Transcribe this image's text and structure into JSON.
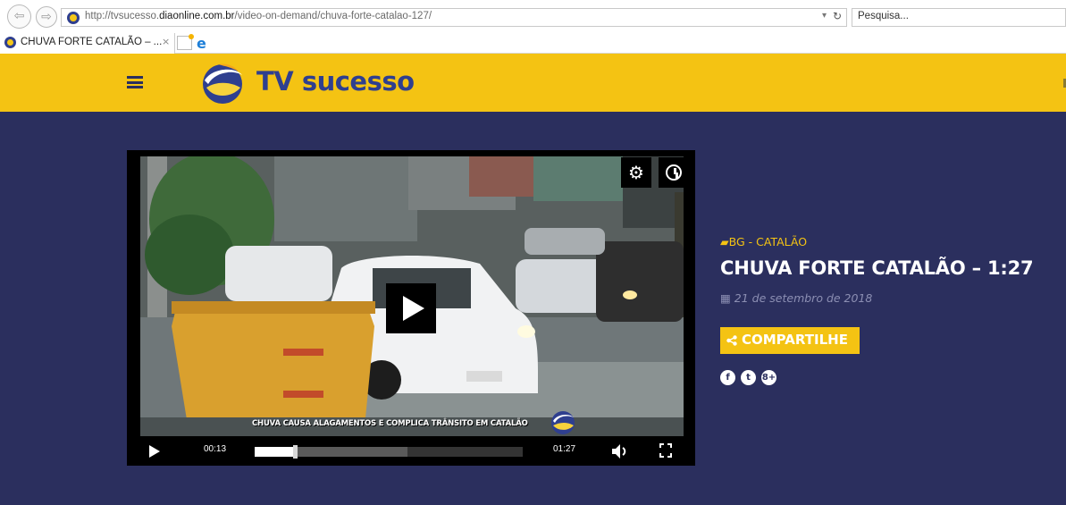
{
  "browser": {
    "url_prefix": "http://tvsucesso.",
    "url_domain": "diaonline.com.br",
    "url_path": "/video-on-demand/chuva-forte-catalao-127/",
    "search_placeholder": "Pesquisa...",
    "tab_title": "CHUVA FORTE CATALÃO – ...",
    "tab_close": "×",
    "back_icon": "back-arrow-icon",
    "forward_icon": "forward-arrow-icon",
    "dropdown_glyph": "▾",
    "refresh_glyph": "↻",
    "ie_glyph": "e"
  },
  "header": {
    "logo_text": "TV sucesso",
    "brand_yellow": "#f4c313",
    "brand_navy": "#2b2f5e"
  },
  "player": {
    "caption": "CHUVA CAUSA ALAGAMENTOS E COMPLICA TRÂNSITO EM CATALÃO",
    "time_current": "00:13",
    "time_total": "01:27",
    "progress_fraction": 0.15,
    "buffered_fraction": 0.57,
    "settings_glyph": "⚙"
  },
  "video": {
    "category": "BG - CATALÃO",
    "title": "CHUVA FORTE CATALÃO – 1:27",
    "date": "21 de setembro de 2018",
    "share_label": "COMPARTILHE",
    "social": [
      "f",
      "t",
      "8+"
    ]
  }
}
